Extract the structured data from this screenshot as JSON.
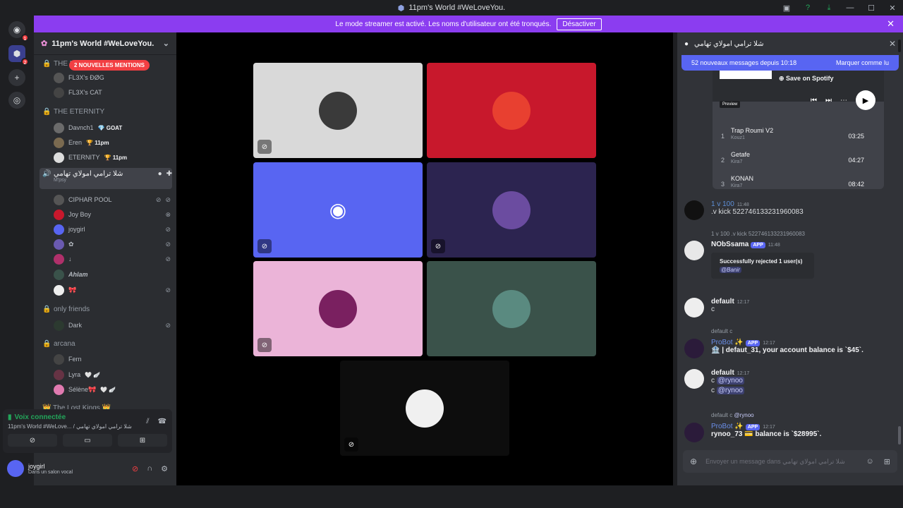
{
  "window": {
    "title": "11pm's World #WeLoveYou."
  },
  "streamer": {
    "text": "Le mode streamer est activé. Les noms d'utilisateur ont été tronqués.",
    "button": "Désactiver"
  },
  "guilds": {
    "badge1": "1",
    "badge2": "1",
    "badge3": "2"
  },
  "server": {
    "name": "11pm's World #WeLoveYou."
  },
  "mentions_pill": "2 NOUVELLES MENTIONS",
  "channels": {
    "c1": "THE NIGHT",
    "c1_users": [
      "FL3X's ĐØG",
      "FL3X's CAT"
    ],
    "c2": "THE ETERNITY",
    "c2_users": [
      {
        "name": "Davnch1",
        "tag": "💎 GOAT"
      },
      {
        "name": "Eren",
        "tag": "🏆 11pm"
      },
      {
        "name": "ETERNITY",
        "tag": "🏆 11pm"
      }
    ],
    "c3": "شلا ترامي امولاي تهامي",
    "c3_sub": "M'psy",
    "c3_users": [
      "CIPHAR POOL",
      "Joy Boy",
      "joygirl",
      "✿",
      "↓",
      "Ahlam",
      "🎀"
    ],
    "c4": "only friends",
    "c4_users": [
      "Dark"
    ],
    "c5": "arcana",
    "c5_users": [
      {
        "name": "Fern",
        "tag": ""
      },
      {
        "name": "Lyra",
        "tag": "🤍 🪽"
      },
      {
        "name": "Sélène🎀",
        "tag": "🤍 🪽"
      }
    ],
    "c6": "👑 The Lost Kings 👑"
  },
  "voice": {
    "status": "Voix connectée",
    "sub": "11pm's World #WeLove... / شلا ترامي امولاي تهامي"
  },
  "userpanel": {
    "name": "joygirl",
    "status": "Dans un salon vocal"
  },
  "chat": {
    "title": "شلا ترامي امولاي تهامي",
    "newbar": "52 nouveaux messages depuis 10:18",
    "mark_read": "Marquer comme lu",
    "spotify": {
      "save": "Save on Spotify",
      "preview": "Preview",
      "tracks": [
        {
          "n": "1",
          "title": "Trap Roumi V2",
          "artist": "Kouz1",
          "dur": "03:25"
        },
        {
          "n": "2",
          "title": "Getafe",
          "artist": "Kira7",
          "dur": "04:27"
        },
        {
          "n": "3",
          "title": "KONAN",
          "artist": "Kira7",
          "dur": "08:42"
        }
      ]
    },
    "m1": {
      "name": "1 v 100",
      "time": "11:48",
      "text": ".v kick 522746133231960083"
    },
    "m2": {
      "reply": "1 v 100 .v kick 522746133231960083",
      "name": "NObSsama",
      "app": "APP",
      "time": "11:48",
      "embed_title": "Successfully rejected 1 user(s)",
      "embed_mention": "@Banir"
    },
    "m3": {
      "name": "default",
      "time": "12:17",
      "text": "c"
    },
    "m4": {
      "reply": "default c",
      "name": "ProBot ✨",
      "app": "APP",
      "time": "12:17",
      "text": "🏦 | defaut_31, your account balance is `$45`."
    },
    "m5": {
      "name": "default",
      "time": "12:17",
      "line1": "c",
      "mention": "@rynoo"
    },
    "m6": {
      "reply": "default c",
      "reply_mention": "@rynoo",
      "name": "ProBot ✨",
      "app": "APP",
      "time": "12:17",
      "text": "rynoo_73 💳 balance is `$28995`."
    },
    "input_placeholder": "Envoyer un message dans شلا ترامي امولاي تهامي"
  },
  "colors": {
    "accent": "#5865f2",
    "streamer": "#8b3df0",
    "tile1": "#d9d9d9",
    "tile2": "#c8182c",
    "tile3": "#5865f2",
    "tile4": "#2c2450",
    "tile5": "#ebb4d8",
    "tile6": "#3a524a",
    "tile7": "#0d0d0d"
  }
}
